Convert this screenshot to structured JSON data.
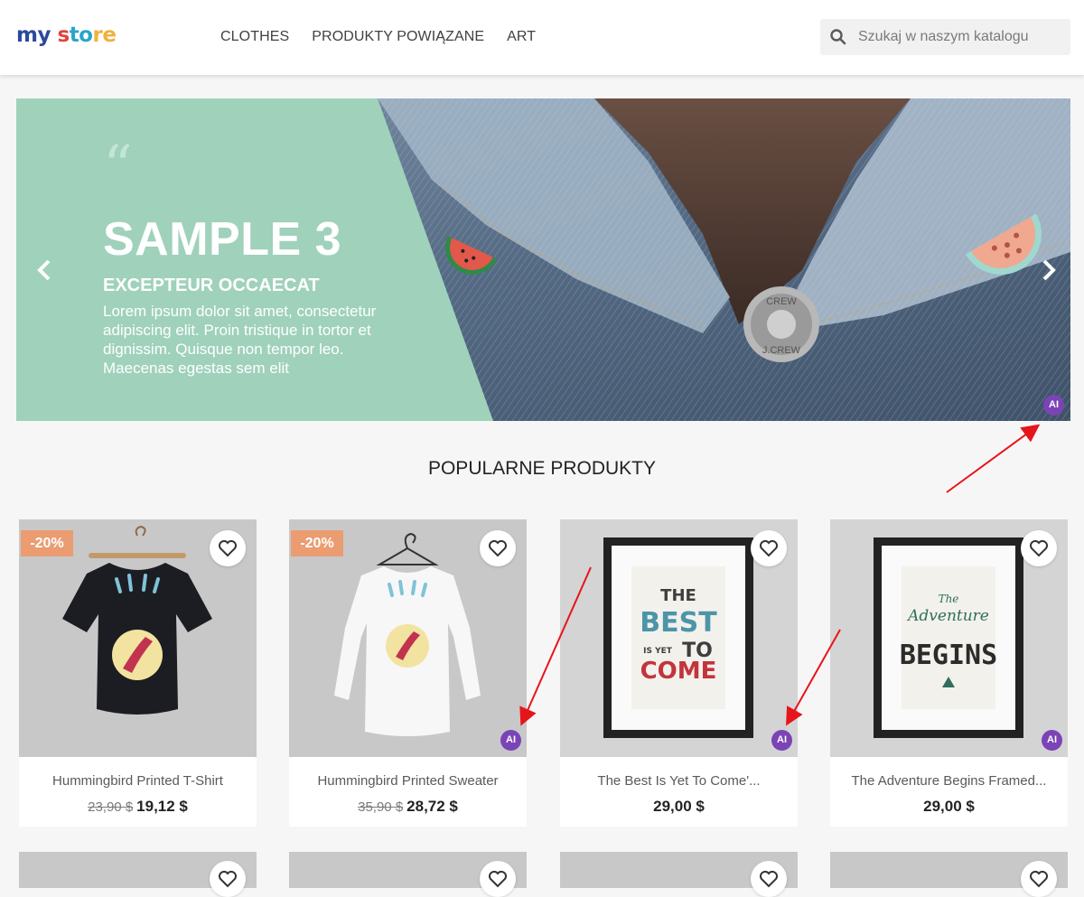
{
  "header": {
    "logo": {
      "part1": "my",
      "part2": "s",
      "part3": "to",
      "part4": "re"
    },
    "nav": [
      "CLOTHES",
      "PRODUKTY POWIĄZANE",
      "ART"
    ],
    "search_placeholder": "Szukaj w naszym katalogu"
  },
  "slider": {
    "quote": "“",
    "title": "SAMPLE 3",
    "subtitle": "EXCEPTEUR OCCAECAT",
    "text": "Lorem ipsum dolor sit amet, consectetur adipiscing elit. Proin tristique in tortor et dignissim. Quisque non tempor leo. Maecenas egestas sem elit",
    "ai_badge": "AI",
    "button_texts": [
      "CREW",
      "J.CREW"
    ]
  },
  "section_title": "POPULARNE PRODUKTY",
  "products": [
    {
      "name": "Hummingbird Printed T-Shirt",
      "discount": "-20%",
      "old_price": "23,90 $",
      "price": "19,12 $",
      "ai": ""
    },
    {
      "name": "Hummingbird Printed Sweater",
      "discount": "-20%",
      "old_price": "35,90 $",
      "price": "28,72 $",
      "ai": "AI"
    },
    {
      "name": "The Best Is Yet To Come'...",
      "discount": "",
      "old_price": "",
      "price": "29,00 $",
      "ai": "AI"
    },
    {
      "name": "The Adventure Begins Framed...",
      "discount": "",
      "old_price": "",
      "price": "29,00 $",
      "ai": "AI"
    }
  ],
  "poster_best": {
    "l1": "THE",
    "l2": "BEST",
    "l3": "IS YET",
    "l4": "TO",
    "l5": "COME"
  },
  "poster_adventure": {
    "l1": "The",
    "l2": "Adventure",
    "l3": "BEGINS"
  },
  "colors": {
    "accent_ai": "#7a44b6",
    "discount": "#eb9c71",
    "slide_green": "#9fd1bb",
    "annotation": "#e8141b"
  }
}
